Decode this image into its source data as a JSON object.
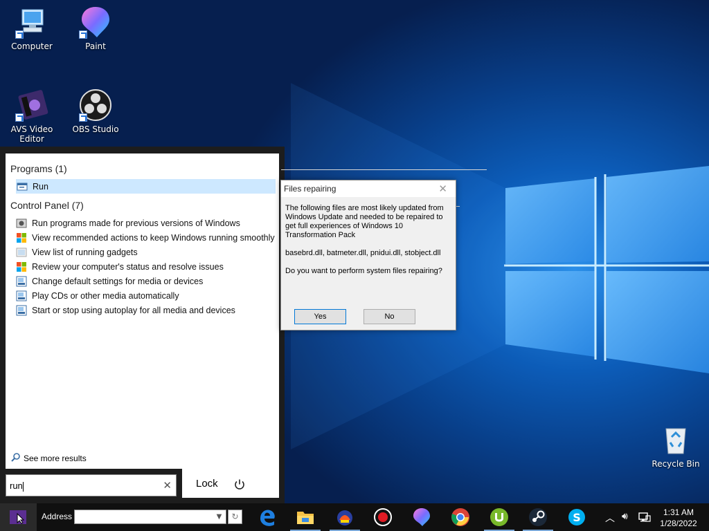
{
  "desktop": {
    "icons": [
      {
        "label": "Computer"
      },
      {
        "label": "Paint"
      },
      {
        "label": "AVS Video Editor"
      },
      {
        "label": "OBS Studio"
      }
    ],
    "recycle_bin": {
      "label": "Recycle Bin"
    }
  },
  "start_menu": {
    "programs_header": "Programs (1)",
    "programs": [
      {
        "label": "Run",
        "icon": "run-icon",
        "selected": true
      }
    ],
    "control_panel_header": "Control Panel (7)",
    "control_panel": [
      {
        "label": "Run programs made for previous versions of Windows",
        "icon": "compatibility-icon"
      },
      {
        "label": "View recommended actions to keep Windows running smoothly",
        "icon": "action-center-icon"
      },
      {
        "label": "View list of running gadgets",
        "icon": "gadgets-icon"
      },
      {
        "label": "Review your computer's status and resolve issues",
        "icon": "action-center-icon"
      },
      {
        "label": "Change default settings for media or devices",
        "icon": "autoplay-icon"
      },
      {
        "label": "Play CDs or other media automatically",
        "icon": "autoplay-icon"
      },
      {
        "label": "Start or stop using autoplay for all media and devices",
        "icon": "autoplay-icon"
      }
    ],
    "see_more": "See more results",
    "search_value": "run",
    "lock_label": "Lock"
  },
  "dialog": {
    "title": "Files repairing",
    "message": "The following files are most likely updated from Windows Update and needed to be repaired to get full experiences of Windows 10 Transformation Pack",
    "files": "basebrd.dll, batmeter.dll, pnidui.dll, stobject.dll",
    "question": "Do you want to perform system files repairing?",
    "yes_label": "Yes",
    "no_label": "No"
  },
  "taskbar": {
    "address_label": "Address",
    "address_value": "",
    "apps": [
      "edge-icon",
      "file-explorer-icon",
      "app-icon",
      "record-icon",
      "paint-icon",
      "chrome-icon",
      "utorrent-icon",
      "steam-icon",
      "skype-icon"
    ],
    "clock": {
      "time": "1:31 AM",
      "date": "1/28/2022"
    }
  },
  "colors": {
    "start_menu_bg": "#1d1d1d",
    "selection": "#cde8ff",
    "taskbar_bg": "#101010",
    "accent": "#0078d7"
  }
}
